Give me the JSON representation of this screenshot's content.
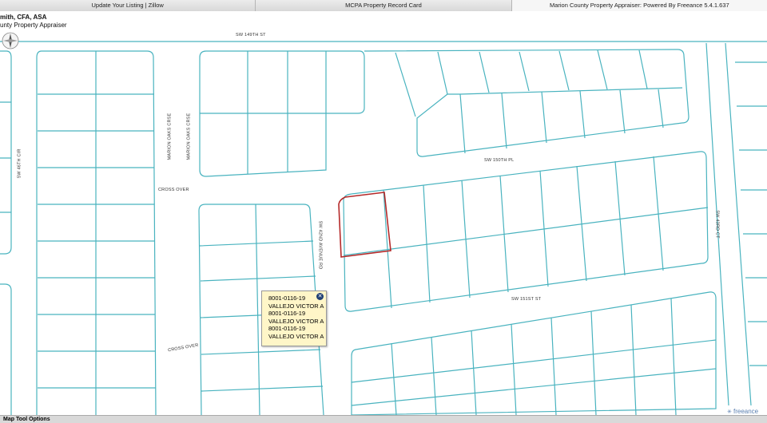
{
  "browser_tabs": [
    {
      "label": "Update Your Listing | Zillow",
      "active": false
    },
    {
      "label": "MCPA Property Record Card",
      "active": false
    },
    {
      "label": "Marion County Property Appraiser: Powered By Freeance 5.4.1.637",
      "active": true
    }
  ],
  "header": {
    "line1": "mith, CFA, ASA",
    "line2": "unty Property Appraiser"
  },
  "map": {
    "parcel_color": "#49b3bf",
    "selected_parcel_color": "#b52a2a",
    "road_labels": {
      "sw149": "SW 149TH ST",
      "sw150pl": "SW 150TH PL",
      "sw151": "SW 151ST ST",
      "sw46": "SW 46TH CIR",
      "marion1": "MARION OAKS CRSE",
      "marion2": "MARION OAKS CRSE",
      "crossover1": "CROSS OVER",
      "crossover2": "CROSS OVER",
      "sw42ave": "SW 42ND AVENUE RD",
      "sw43": "SW 43RD CT"
    }
  },
  "popup": {
    "lines": [
      "8001-0116-19",
      "VALLEJO VICTOR A",
      "8001-0116-19",
      "VALLEJO VICTOR A",
      "8001-0116-19",
      "VALLEJO VICTOR A"
    ],
    "close_icon": "close-icon"
  },
  "footer": {
    "tool_options_label": "Map Tool Options",
    "brand": "freeance"
  },
  "icons": {
    "compass": "compass-icon"
  }
}
